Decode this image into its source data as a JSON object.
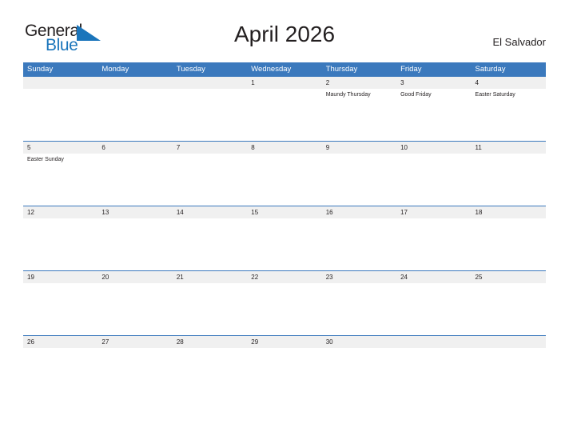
{
  "header": {
    "logo": {
      "text_primary": "General",
      "text_secondary": "Blue",
      "flag_icon": "triangle-flag-icon",
      "primary_color": "#231f20",
      "secondary_color": "#1a75bb"
    },
    "title": "April 2026",
    "country": "El Salvador"
  },
  "calendar": {
    "header_color": "#3b79bd",
    "band_color": "#f0f0f0",
    "day_names": [
      "Sunday",
      "Monday",
      "Tuesday",
      "Wednesday",
      "Thursday",
      "Friday",
      "Saturday"
    ],
    "weeks": [
      [
        {
          "date": "",
          "events": []
        },
        {
          "date": "",
          "events": []
        },
        {
          "date": "",
          "events": []
        },
        {
          "date": "1",
          "events": []
        },
        {
          "date": "2",
          "events": [
            "Maundy Thursday"
          ]
        },
        {
          "date": "3",
          "events": [
            "Good Friday"
          ]
        },
        {
          "date": "4",
          "events": [
            "Easter Saturday"
          ]
        }
      ],
      [
        {
          "date": "5",
          "events": [
            "Easter Sunday"
          ]
        },
        {
          "date": "6",
          "events": []
        },
        {
          "date": "7",
          "events": []
        },
        {
          "date": "8",
          "events": []
        },
        {
          "date": "9",
          "events": []
        },
        {
          "date": "10",
          "events": []
        },
        {
          "date": "11",
          "events": []
        }
      ],
      [
        {
          "date": "12",
          "events": []
        },
        {
          "date": "13",
          "events": []
        },
        {
          "date": "14",
          "events": []
        },
        {
          "date": "15",
          "events": []
        },
        {
          "date": "16",
          "events": []
        },
        {
          "date": "17",
          "events": []
        },
        {
          "date": "18",
          "events": []
        }
      ],
      [
        {
          "date": "19",
          "events": []
        },
        {
          "date": "20",
          "events": []
        },
        {
          "date": "21",
          "events": []
        },
        {
          "date": "22",
          "events": []
        },
        {
          "date": "23",
          "events": []
        },
        {
          "date": "24",
          "events": []
        },
        {
          "date": "25",
          "events": []
        }
      ],
      [
        {
          "date": "26",
          "events": []
        },
        {
          "date": "27",
          "events": []
        },
        {
          "date": "28",
          "events": []
        },
        {
          "date": "29",
          "events": []
        },
        {
          "date": "30",
          "events": []
        },
        {
          "date": "",
          "events": []
        },
        {
          "date": "",
          "events": []
        }
      ]
    ]
  }
}
